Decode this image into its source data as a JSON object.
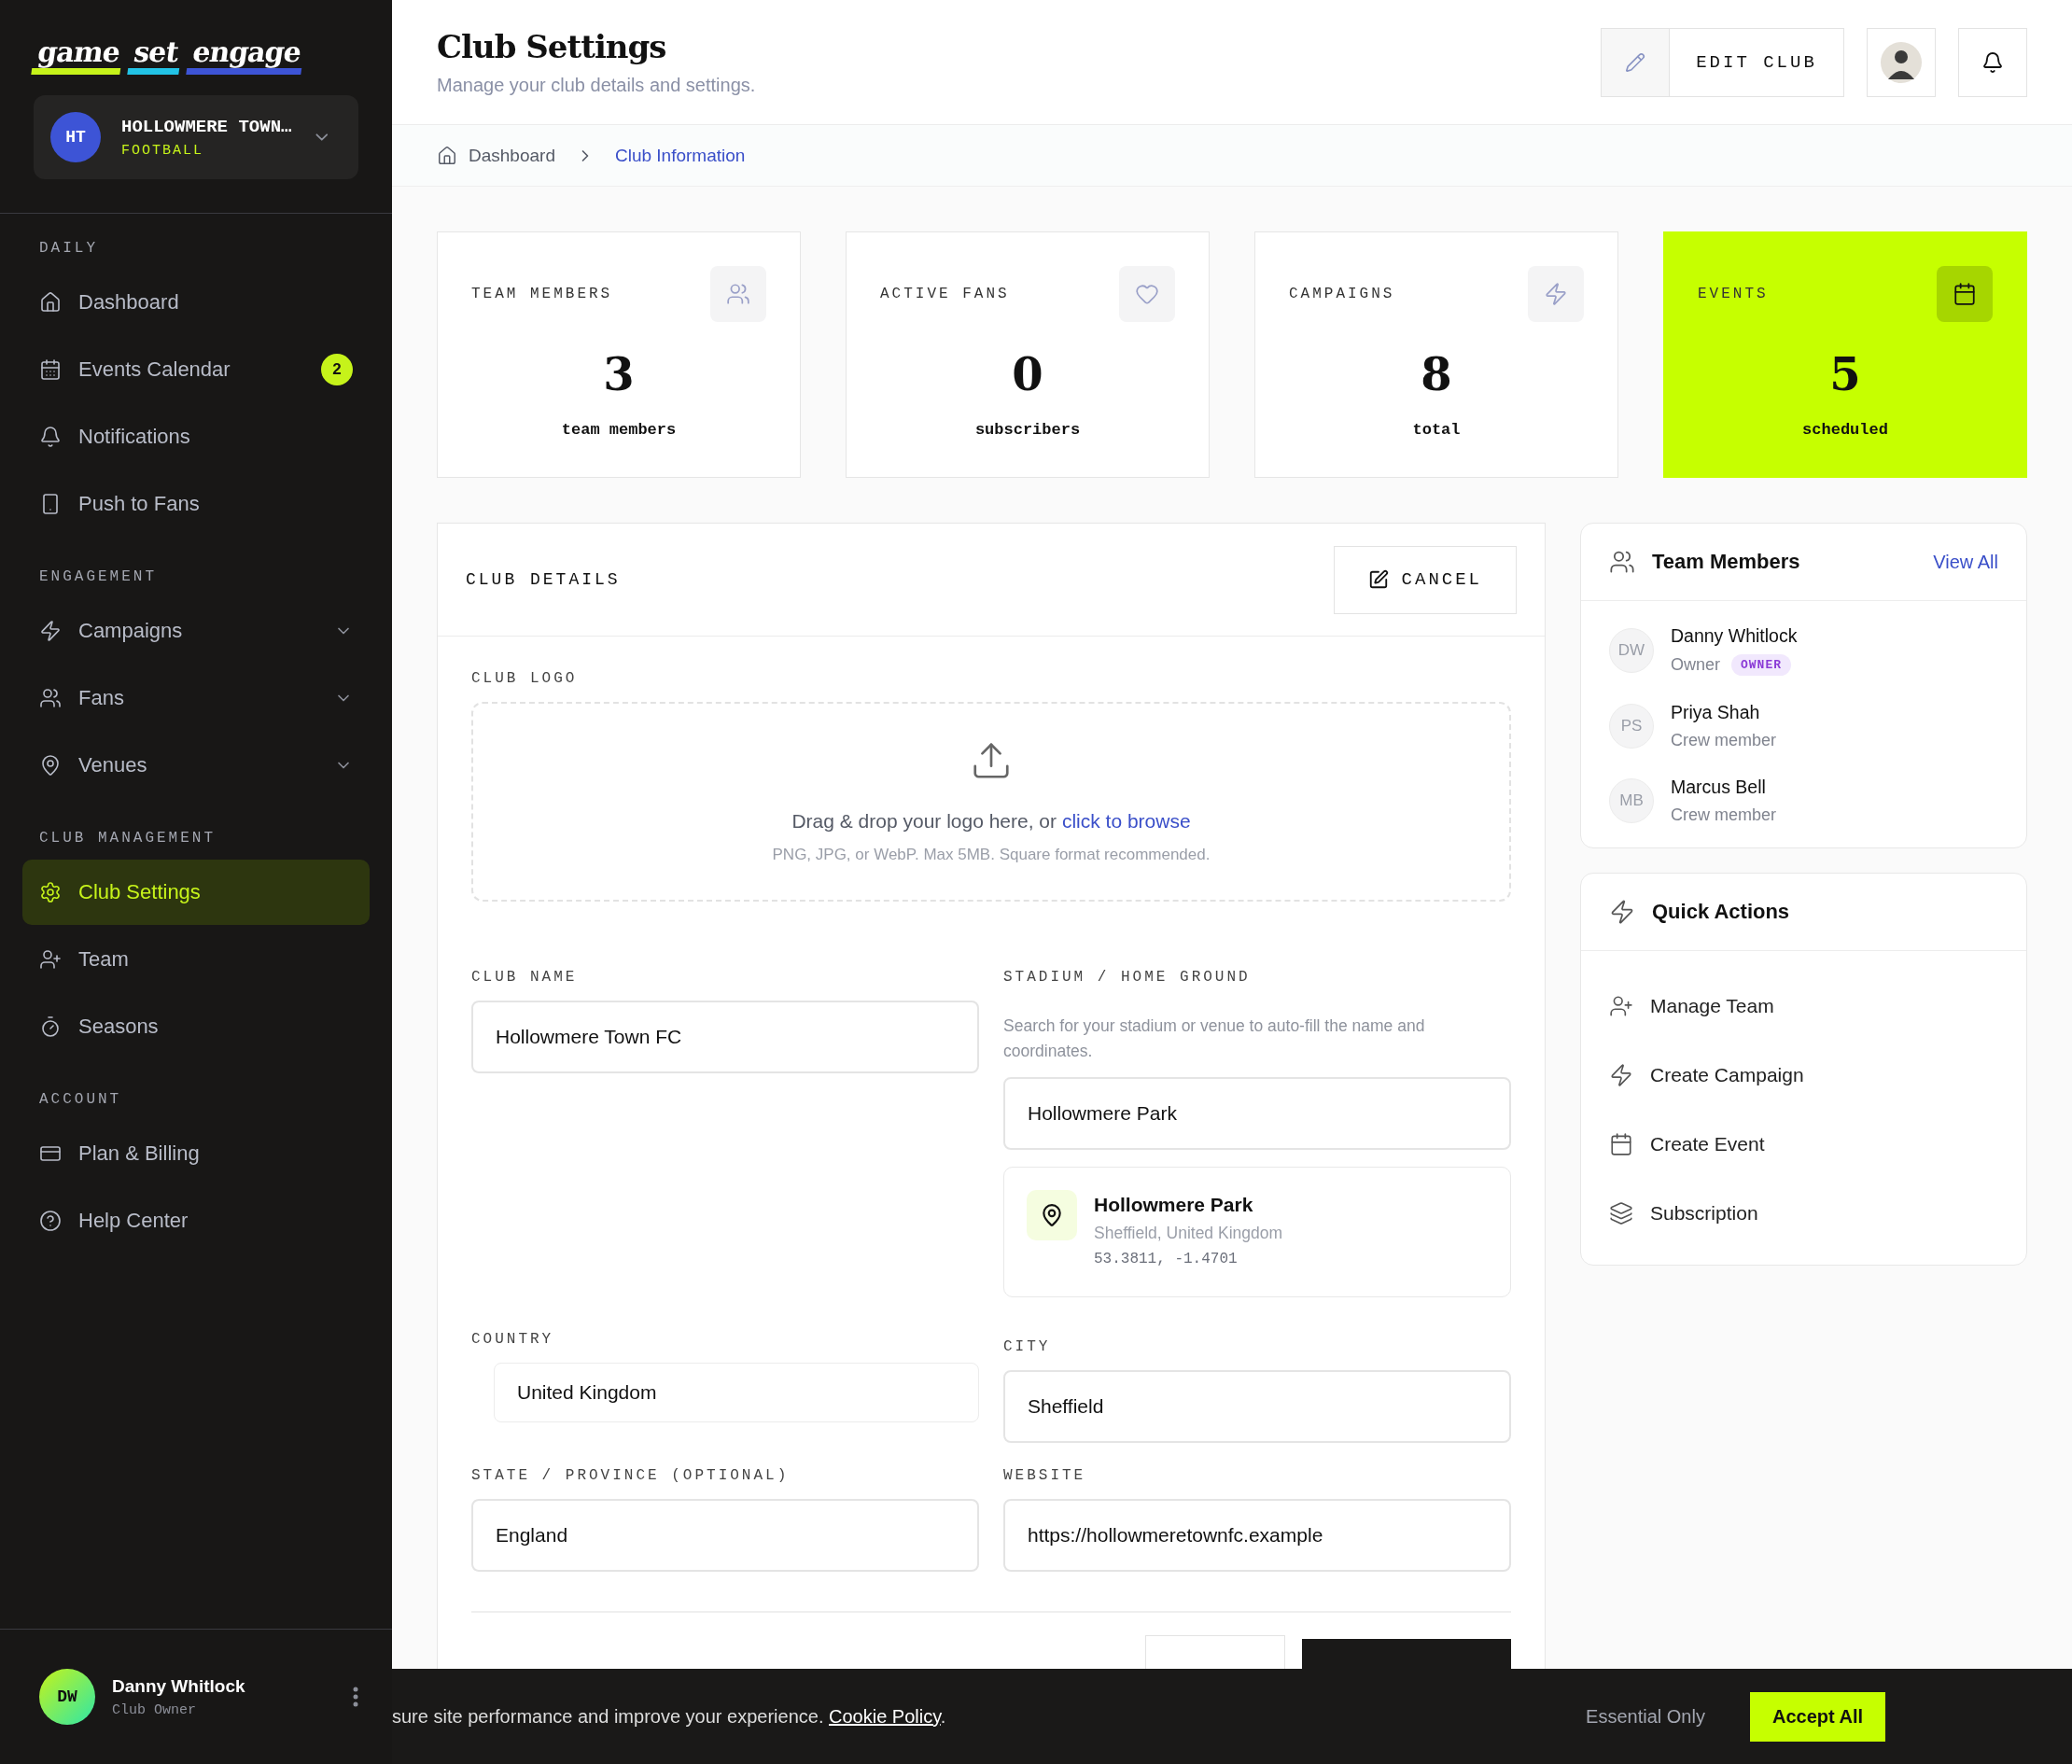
{
  "brand": {
    "words": [
      {
        "text": "game",
        "color": "#c6f31a"
      },
      {
        "text": "set",
        "color": "#22c3e6"
      },
      {
        "text": "engage",
        "color": "#3d54d6"
      }
    ]
  },
  "club_switcher": {
    "initials": "HT",
    "name": "HOLLOWMERE TOWN…",
    "sport": "FOOTBALL"
  },
  "nav": [
    {
      "heading": "DAILY",
      "items": [
        {
          "label": "Dashboard",
          "kind": "link",
          "selected": false
        },
        {
          "label": "Events Calendar",
          "kind": "link",
          "badge": "2",
          "selected": false
        },
        {
          "label": "Notifications",
          "kind": "link",
          "selected": false
        },
        {
          "label": "Push to Fans",
          "kind": "link",
          "selected": false
        }
      ]
    },
    {
      "heading": "ENGAGEMENT",
      "items": [
        {
          "label": "Campaigns",
          "kind": "menu",
          "expanded": false,
          "selected": false
        },
        {
          "label": "Fans",
          "kind": "menu",
          "expanded": false,
          "selected": false
        },
        {
          "label": "Venues",
          "kind": "menu",
          "expanded": false,
          "selected": false
        }
      ]
    },
    {
      "heading": "CLUB MANAGEMENT",
      "items": [
        {
          "label": "Club Settings",
          "kind": "link",
          "selected": true
        },
        {
          "label": "Team",
          "kind": "link",
          "selected": false
        },
        {
          "label": "Seasons",
          "kind": "link",
          "selected": false
        }
      ]
    },
    {
      "heading": "ACCOUNT",
      "items": [
        {
          "label": "Plan & Billing",
          "kind": "link",
          "selected": false
        },
        {
          "label": "Help Center",
          "kind": "link",
          "selected": false
        }
      ]
    }
  ],
  "user": {
    "initials": "DW",
    "name": "Danny Whitlock",
    "role": "Club Owner"
  },
  "header": {
    "title": "Club Settings",
    "subtitle": "Manage your club details and settings.",
    "edit_button": "EDIT CLUB"
  },
  "breadcrumb": [
    {
      "label": "Dashboard",
      "selected": false
    },
    {
      "label": "Club Information",
      "selected": true
    }
  ],
  "stats": [
    {
      "label": "TEAM MEMBERS",
      "value": "3",
      "caption": "team members",
      "highlighted": false
    },
    {
      "label": "ACTIVE FANS",
      "value": "0",
      "caption": "subscribers",
      "highlighted": false
    },
    {
      "label": "CAMPAIGNS",
      "value": "8",
      "caption": "total",
      "highlighted": false
    },
    {
      "label": "EVENTS",
      "value": "5",
      "caption": "scheduled",
      "highlighted": true
    }
  ],
  "club_details": {
    "title": "CLUB DETAILS",
    "cancel_button": "CANCEL",
    "logo_label": "CLUB LOGO",
    "upload": {
      "text": "Drag & drop your logo here, or ",
      "link": "click to browse",
      "hint": "PNG, JPG, or WebP. Max 5MB. Square format recommended."
    },
    "club_name": {
      "label": "CLUB NAME",
      "value": "Hollowmere Town FC"
    },
    "stadium": {
      "label": "STADIUM / HOME GROUND",
      "help": "Search for your stadium or venue to auto-fill the name and coordinates.",
      "value": "Hollowmere Park",
      "result": {
        "name": "Hollowmere Park",
        "place": "Sheffield, United Kingdom",
        "coords": "53.3811, -1.4701"
      }
    },
    "country": {
      "label": "COUNTRY",
      "value": "United Kingdom"
    },
    "city": {
      "label": "CITY",
      "value": "Sheffield"
    },
    "state": {
      "label": "STATE / PROVINCE (OPTIONAL)",
      "value": "England"
    },
    "website": {
      "label": "WEBSITE",
      "value": "https://hollowmeretownfc.example"
    }
  },
  "team_panel": {
    "title": "Team Members",
    "view_all": "View All",
    "members": [
      {
        "initials": "DW",
        "name": "Danny Whitlock",
        "role": "Owner",
        "badge": "OWNER"
      },
      {
        "initials": "PS",
        "name": "Priya Shah",
        "role": "Crew member"
      },
      {
        "initials": "MB",
        "name": "Marcus Bell",
        "role": "Crew member"
      }
    ]
  },
  "quick_actions": {
    "title": "Quick Actions",
    "items": [
      "Manage Team",
      "Create Campaign",
      "Create Event",
      "Subscription"
    ]
  },
  "cookie_bar": {
    "text": "sure site performance and improve your experience. ",
    "link": "Cookie Policy",
    "end": ".",
    "buttons": [
      "Essential Only",
      "Accept All"
    ]
  }
}
